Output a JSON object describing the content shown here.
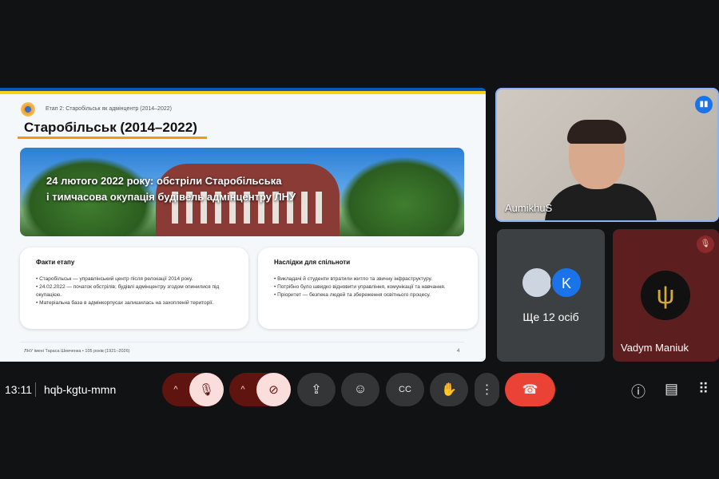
{
  "slide": {
    "breadcrumb": "Етап 2: Старобільськ як адмінцентр (2014–2022)",
    "title": "Старобільськ (2014–2022)",
    "banner_line1": "24 лютого 2022 року: обстріли Старобільська",
    "banner_line2": "і тимчасова окупація будівель адмінцентру ЛНУ",
    "cards": [
      {
        "heading": "Факти етапу",
        "items": [
          "• Старобільськ — управлінський центр після релокації 2014 року.",
          "• 24.02.2022 — початок обстрілів; будівлі адмінцентру згодом опинилися під окупацією.",
          "• Матеріальна база в адмінкорпусах залишилась на захопленій території."
        ]
      },
      {
        "heading": "Наслідки для спільноти",
        "items": [
          "• Викладачі й студенти втратили житло та звичну інфраструктуру.",
          "• Потрібно було швидко відновити управління, комунікації та навчання.",
          "• Пріоритет — безпека людей та збереження освітнього процесу."
        ]
      }
    ],
    "footer": "ЛНУ імені Тараса Шевченка • 105 років (1921–2026)",
    "page_number": "4"
  },
  "participants": {
    "speaker": "AumikhuS",
    "others_avatar_letter": "K",
    "others_label": "Ще 12 осіб",
    "third": "Vadym Maniuk"
  },
  "meeting": {
    "time": "13:11",
    "code": "hqb-kgtu-mmn"
  },
  "icons": {
    "chevron": "^",
    "mic_off": "🎙",
    "cam_off": "⊘",
    "present": "⇪",
    "emoji": "☺",
    "cc": "CC",
    "hand": "✋",
    "more": "⋮",
    "end": "☎",
    "info": "ⓘ",
    "chat": "▤",
    "apps": "⠿",
    "speaking": "▮▮",
    "trident": "ψ"
  }
}
